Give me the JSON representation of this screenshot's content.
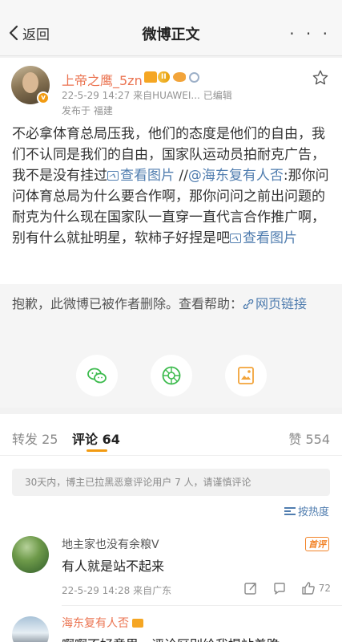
{
  "nav": {
    "back_label": "返回",
    "title": "微博正文",
    "more_label": "· · ·"
  },
  "post": {
    "author": "上帝之鹰_5zn",
    "level": "II",
    "timestamp": "22-5-29 14:27",
    "source": "来自HUAWEI...",
    "edited": "已编辑",
    "location": "发布于 福建",
    "content": {
      "seg1": "不必拿体育总局压我，他们的态度是他们的自由，我们不认同是我们的自由，国家队运动员拍耐克广告，我不是没有挂过",
      "pic_link1": "查看图片",
      "seg2": " //",
      "mention": "@海东复有人否",
      "seg3": ":那你问问体育总局为什么要合作啊，那你问问之前出问题的耐克为什么现在国家队一直穿一直代言合作推广啊，别有什么就扯明星，软柿子好捏是吧",
      "pic_link2": "查看图片"
    }
  },
  "deleted_notice": {
    "text": "抱歉，此微博已被作者删除。查看帮助：",
    "link": "网页链接"
  },
  "share": {
    "wechat": "wechat-share",
    "moments": "moments-share",
    "save_image": "save-image"
  },
  "tabs": {
    "repost_label": "转发",
    "repost_count": "25",
    "comment_label": "评论",
    "comment_count": "64",
    "like_label": "赞",
    "like_count": "554"
  },
  "comments_notice": "30天内，博主已拉黑恶意评论用户 7 人，请谨慎评论",
  "sort_label": "按热度",
  "comments": [
    {
      "user": "地主家也没有余粮V",
      "tag": "首评",
      "text": "有人就是站不起来",
      "time": "22-5-29 14:28",
      "source": "来自广东",
      "likes": "72"
    },
    {
      "user": "海东复有人否",
      "text": "啊啊不好意思，评论区别给我提站着跪"
    }
  ],
  "colors": {
    "accent": "#f29b12",
    "link": "#507daf",
    "username": "#eb7350"
  }
}
